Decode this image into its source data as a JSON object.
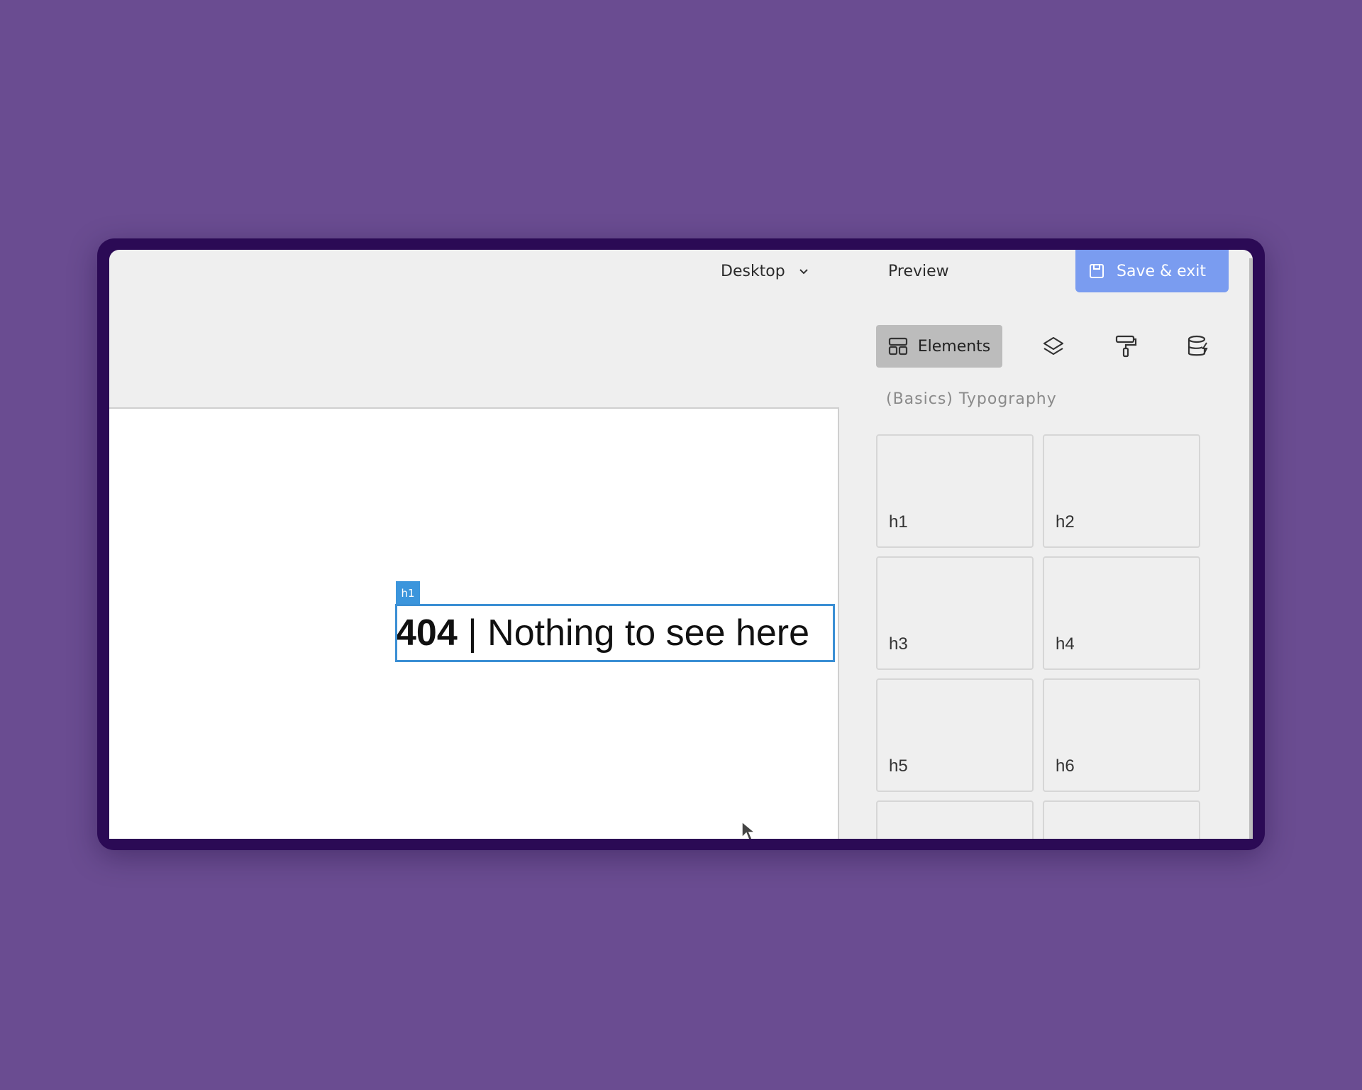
{
  "topbar": {
    "device_label": "Desktop",
    "preview_label": "Preview",
    "save_label": "Save & exit"
  },
  "canvas": {
    "selected_tag": "h1",
    "heading_bold": "404",
    "heading_rest": " | Nothing to see here"
  },
  "panel": {
    "tabs": [
      {
        "label": "Elements",
        "icon": "elements-icon",
        "active": true
      },
      {
        "label": "",
        "icon": "layers-icon"
      },
      {
        "label": "",
        "icon": "paint-roller-icon"
      },
      {
        "label": "",
        "icon": "database-icon"
      }
    ],
    "section_title": "(Basics) Typography",
    "tiles": [
      "h1",
      "h2",
      "h3",
      "h4",
      "h5",
      "h6"
    ]
  },
  "colors": {
    "background": "#6a4c91",
    "frame": "#2b0a55",
    "accent": "#7a9cf0",
    "selection": "#3b8fd4"
  }
}
